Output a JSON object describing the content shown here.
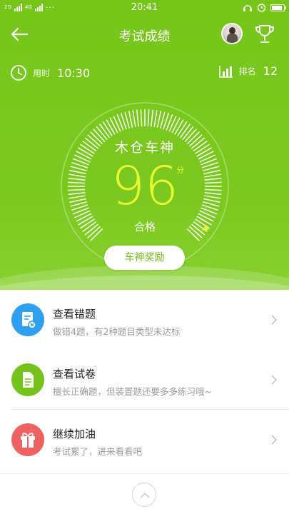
{
  "status": {
    "network": "4G",
    "sim": "2G",
    "time": "20:41"
  },
  "header": {
    "title": "考试成绩"
  },
  "meta": {
    "time_label": "用时",
    "time_value": "10:30",
    "rank_label": "排名",
    "rank_value": "12"
  },
  "gauge": {
    "name": "木仓车神",
    "score": "96",
    "unit": "分",
    "result": "合格",
    "progress": 0.96
  },
  "reward_button": "车神奖励",
  "list": [
    {
      "title": "查看错题",
      "subtitle": "做错4题，有2种题目类型未达标",
      "icon": "wrong-questions-icon",
      "color": "#2f9ff0"
    },
    {
      "title": "查看试卷",
      "subtitle": "擅长正确题，但装置题还要多多练习哦~",
      "icon": "paper-icon",
      "color": "#75c21b"
    },
    {
      "title": "继续加油",
      "subtitle": "考试累了，进来看看吧",
      "icon": "gift-icon",
      "color": "#ee6262"
    }
  ],
  "colors": {
    "header_green": "#76c61a",
    "score_yellow": "#e9f732",
    "accent_green": "#6fbf18"
  }
}
